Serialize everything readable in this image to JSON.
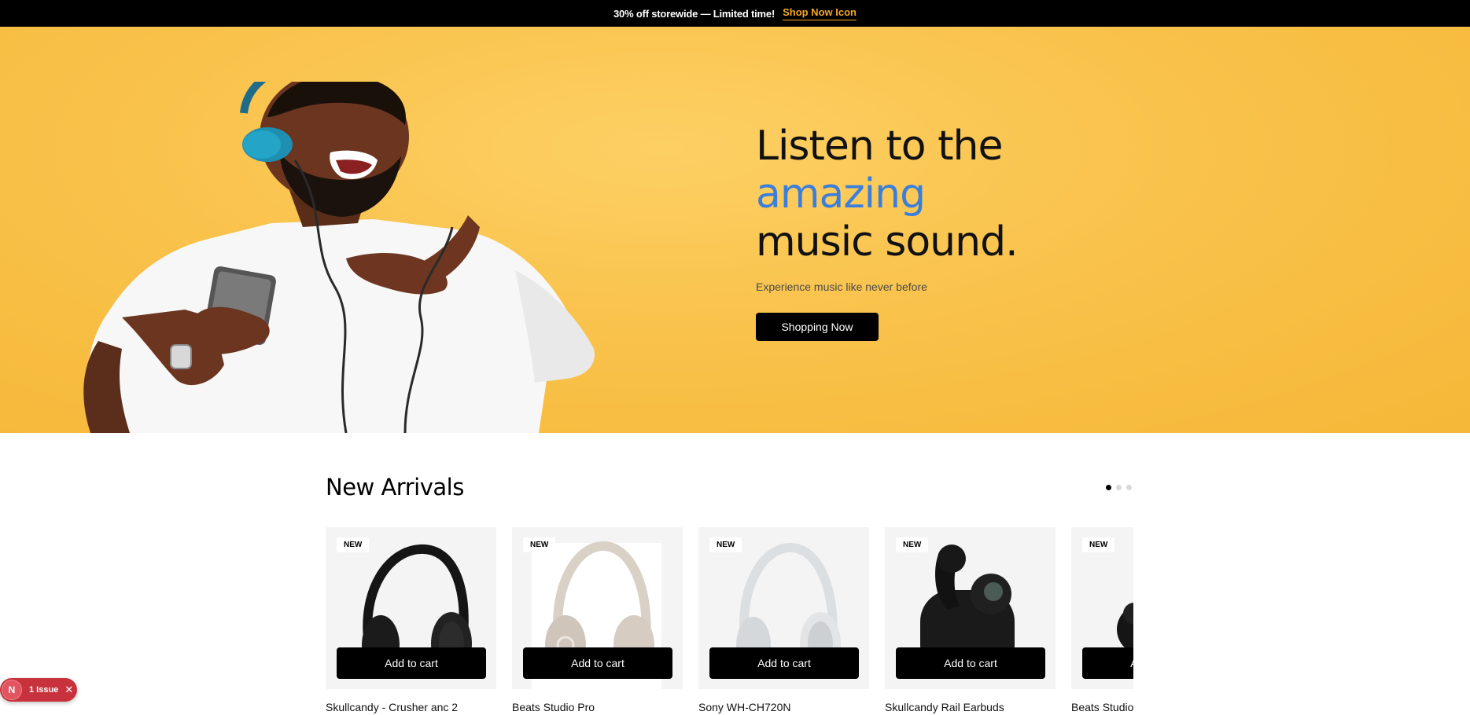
{
  "announcement": {
    "promo_text": "30% off storewide — Limited time!",
    "link_text": "Shop Now Icon",
    "link_color": "#f5a623"
  },
  "hero": {
    "title_line1": "Listen to the",
    "title_accent": "amazing",
    "title_line3": "music sound.",
    "subtitle": "Experience music like never before",
    "button_label": "Shopping Now",
    "accent_color": "#3b7fdc",
    "background_color": "#f9c24b"
  },
  "new_arrivals": {
    "title": "New Arrivals",
    "carousel_pages": 3,
    "active_page": 1,
    "products": [
      {
        "badge": "NEW",
        "name": "Skullcandy - Crusher anc 2",
        "button": "Add to cart",
        "image": "black-over-ear-headphones"
      },
      {
        "badge": "NEW",
        "name": "Beats Studio Pro",
        "button": "Add to cart",
        "image": "sandstone-over-ear-headphones"
      },
      {
        "badge": "NEW",
        "name": "Sony WH-CH720N",
        "button": "Add to cart",
        "image": "white-over-ear-headphones"
      },
      {
        "badge": "NEW",
        "name": "Skullcandy Rail Earbuds",
        "button": "Add to cart",
        "image": "black-wireless-earbuds"
      },
      {
        "badge": "NEW",
        "name": "Beats Studio",
        "button": "Add to cart",
        "image": "black-earbuds"
      }
    ]
  },
  "dev_overlay": {
    "avatar_letter": "N",
    "label": "1 Issue",
    "close_icon": "close-icon"
  }
}
